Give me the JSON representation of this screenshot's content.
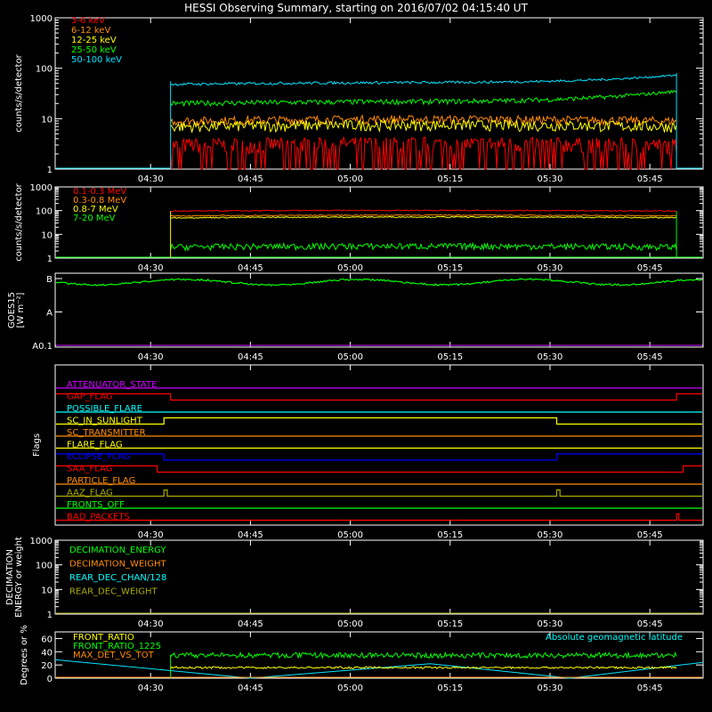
{
  "title": "HESSI Observing Summary, starting on 2016/07/02 04:15:40 UT",
  "colors": {
    "background": "#000000",
    "axes": "#ffffff",
    "red": "#ff0000",
    "orange": "#ff8c00",
    "yellow": "#ffff00",
    "green": "#00ff00",
    "cyan": "#00e5ff",
    "magenta": "#cc00ff",
    "blue": "#0000ff",
    "olive": "#aaaa00",
    "bright_cyan": "#00ffff"
  },
  "x_ticks": [
    "04:30",
    "04:45",
    "05:00",
    "05:15",
    "05:30",
    "05:45"
  ],
  "chart_data": [
    {
      "type": "line",
      "panel": "lightcurve",
      "ylabel": "counts/s/detector",
      "yscale": "log",
      "ylim": [
        1,
        1000
      ],
      "y_ticks": [
        "1",
        "10",
        "100",
        "1000"
      ],
      "x_range": [
        "04:15:40",
        "05:53:00"
      ],
      "data_window": [
        "04:33",
        "05:49"
      ],
      "legend": "top-left",
      "series": [
        {
          "name": "3-6 keV",
          "color": "red",
          "level": 3,
          "ramp": 0
        },
        {
          "name": "6-12 keV",
          "color": "orange",
          "level": 9,
          "ramp": 0
        },
        {
          "name": "12-25 keV",
          "color": "yellow",
          "level": 7,
          "ramp": 0
        },
        {
          "name": "25-50 keV",
          "color": "green",
          "level": 20,
          "ramp": 15
        },
        {
          "name": "50-100 keV",
          "color": "cyan",
          "level": 48,
          "ramp": 25
        }
      ]
    },
    {
      "type": "line",
      "panel": "gamma",
      "ylabel": "counts/s/detector",
      "yscale": "log",
      "ylim": [
        1,
        1000
      ],
      "y_ticks": [
        "1",
        "10",
        "100",
        "1000"
      ],
      "legend": "top-left",
      "series": [
        {
          "name": "0.1-0.3 MeV",
          "color": "red",
          "level": 95
        },
        {
          "name": "0.3-0.8 MeV",
          "color": "orange",
          "level": 60
        },
        {
          "name": "0.8-7 MeV",
          "color": "yellow",
          "level": 50
        },
        {
          "name": "7-20 MeV",
          "color": "green",
          "level": 3
        }
      ]
    },
    {
      "type": "line",
      "panel": "goes",
      "ylabel": "GOES15",
      "ylabel_unit": "[W m⁻²]",
      "yscale": "log",
      "y_ticks": [
        "A0.1",
        "A",
        "B"
      ],
      "ylim_exp": [
        -9,
        -7
      ],
      "series": [
        {
          "name": "GOES15 long",
          "color": "green",
          "level_exp": -7.05
        },
        {
          "name": "GOES15 short",
          "color": "magenta",
          "level_exp": -9.0
        }
      ]
    },
    {
      "type": "line",
      "panel": "flags",
      "ylabel": "Flags",
      "series": [
        {
          "name": "ATTENUATOR_STATE",
          "color": "magenta",
          "steps": []
        },
        {
          "name": "GAP_FLAG",
          "color": "red",
          "steps": [
            [
              "04:15:40",
              1
            ],
            [
              "04:33",
              0
            ],
            [
              "05:49",
              1
            ]
          ]
        },
        {
          "name": "POSSIBLE_FLARE",
          "color": "bright_cyan",
          "steps": []
        },
        {
          "name": "SC_IN_SUNLIGHT",
          "color": "yellow",
          "steps": [
            [
              "04:15:40",
              0
            ],
            [
              "04:32",
              1
            ],
            [
              "05:31",
              0
            ]
          ]
        },
        {
          "name": "SC_TRANSMITTER",
          "color": "orange",
          "steps": []
        },
        {
          "name": "FLARE_FLAG",
          "color": "yellow",
          "steps": []
        },
        {
          "name": "ECLIPSE_FLAG",
          "color": "blue",
          "steps": [
            [
              "04:15:40",
              1
            ],
            [
              "04:32",
              0
            ],
            [
              "05:31",
              1
            ]
          ]
        },
        {
          "name": "SAA_FLAG",
          "color": "red",
          "steps": [
            [
              "04:15:40",
              1
            ],
            [
              "04:31",
              0
            ],
            [
              "05:50",
              1
            ]
          ]
        },
        {
          "name": "PARTICLE_FLAG",
          "color": "orange",
          "steps": []
        },
        {
          "name": "AAZ_FLAG",
          "color": "olive",
          "steps": [
            [
              "04:15:40",
              0
            ],
            [
              "04:32",
              1
            ],
            [
              "04:32:30",
              0
            ],
            [
              "05:31",
              1
            ],
            [
              "05:31:30",
              0
            ]
          ]
        },
        {
          "name": "FRONTS_OFF",
          "color": "green",
          "steps": []
        },
        {
          "name": "BAD_PACKETS",
          "color": "red",
          "steps": [
            [
              "04:15:40",
              0
            ],
            [
              "05:49",
              1
            ],
            [
              "05:49:20",
              0
            ]
          ]
        }
      ]
    },
    {
      "type": "line",
      "panel": "decimation",
      "ylabel": "DECIMATION",
      "ylabel2": "ENERGY or weight",
      "yscale": "log",
      "ylim": [
        1,
        1000
      ],
      "y_ticks": [
        "1",
        "10",
        "100",
        "1000"
      ],
      "legend": "top-left",
      "series": [
        {
          "name": "DECIMATION_ENERGY",
          "color": "green"
        },
        {
          "name": "DECIMATION_WEIGHT",
          "color": "orange"
        },
        {
          "name": "REAR_DEC_CHAN/128",
          "color": "bright_cyan"
        },
        {
          "name": "REAR_DEC_WEIGHT",
          "color": "olive"
        }
      ]
    },
    {
      "type": "line",
      "panel": "ratios",
      "ylabel": "Degrees or %",
      "ylim": [
        0,
        70
      ],
      "y_ticks": [
        "0",
        "20",
        "40",
        "60"
      ],
      "annotation": "Absolute geomagnetic latitude",
      "legend": "top-left",
      "series": [
        {
          "name": "FRONT_RATIO",
          "color": "yellow",
          "level": 16
        },
        {
          "name": "FRONT_RATIO_1225",
          "color": "green",
          "level": 35
        },
        {
          "name": "MAX_DET_VS_TOT",
          "color": "orange",
          "level": 0
        },
        {
          "name": "Absolute geomagnetic latitude",
          "color": "cyan",
          "level": 0
        }
      ]
    }
  ]
}
